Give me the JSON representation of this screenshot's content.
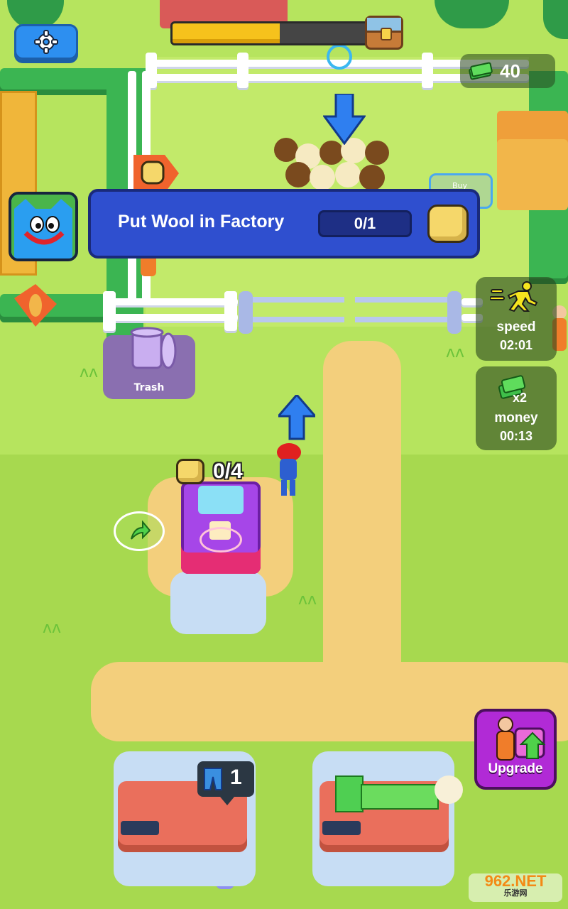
{
  "hud": {
    "cash_value": "40",
    "chest_progress_fraction": 0.55
  },
  "task": {
    "title": "Put Wool in Factory",
    "counter": "0/1"
  },
  "boosts": {
    "speed_label": "speed",
    "speed_timer": "02:01",
    "money_multiplier": "x2",
    "money_label": "money",
    "money_timer": "00:13"
  },
  "world": {
    "pen_buy_label": "Buy",
    "trash_label": "Trash",
    "factory_counter": "0/4",
    "stall_count": "1"
  },
  "upgrade": {
    "label": "Upgrade"
  },
  "watermark": {
    "brand": "962.NET",
    "sub": "乐游网"
  },
  "colors": {
    "accent_blue": "#2f4fcf",
    "cash_green": "#3fbf4a",
    "upgrade_purple": "#b12ad6",
    "progress_yellow": "#f6c21c"
  },
  "icons": [
    "settings-gear-icon",
    "treasure-chest-icon",
    "cash-stack-icon",
    "wool-ball-icon",
    "running-man-icon",
    "money-multiplier-icon",
    "trash-can-icon",
    "upgrade-arrow-icon"
  ]
}
